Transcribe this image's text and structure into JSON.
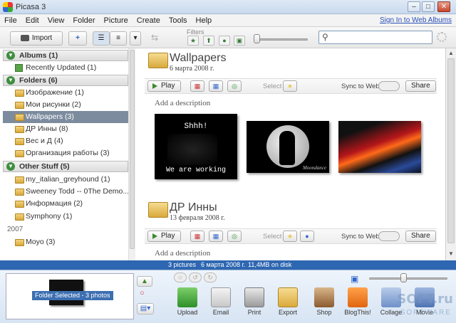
{
  "window": {
    "title": "Picasa 3",
    "minimize": "–",
    "maximize": "□",
    "close": "✕"
  },
  "menu": {
    "items": [
      "File",
      "Edit",
      "View",
      "Folder",
      "Picture",
      "Create",
      "Tools",
      "Help"
    ],
    "signin": "Sign In to Web Albums"
  },
  "toolbar": {
    "import_label": "Import",
    "filters_label": "Filters",
    "search_placeholder": ""
  },
  "sidebar": {
    "sections": [
      {
        "label": "Albums (1)"
      },
      {
        "label": "Folders (6)"
      },
      {
        "label": "Other Stuff (5)"
      }
    ],
    "albums": [
      {
        "label": "Recently Updated (1)"
      }
    ],
    "folders": [
      {
        "label": "Изображение (1)"
      },
      {
        "label": "Мои рисунки (2)"
      },
      {
        "label": "Wallpapers (3)",
        "selected": true
      },
      {
        "label": "ДР Инны (8)"
      },
      {
        "label": "Вес и Д (4)"
      },
      {
        "label": "Организация работы (3)"
      }
    ],
    "other": [
      {
        "label": "my_italian_greyhound (1)"
      },
      {
        "label": "Sweeney Todd -- 0The Demo..."
      },
      {
        "label": "Информация (2)"
      },
      {
        "label": "Symphony (1)"
      }
    ],
    "year": "2007",
    "year_items": [
      {
        "label": "Moyo (3)"
      }
    ]
  },
  "albums_view": [
    {
      "title": "Wallpapers",
      "date": "6 марта 2008 г.",
      "play_label": "Play",
      "select_label": "Select",
      "sync_label": "Sync to Web",
      "share_label": "Share",
      "description_placeholder": "Add a description",
      "thumbs": [
        {
          "line1": "Shhh!",
          "line2": "We are working"
        },
        {
          "caption": "Moondance"
        },
        {
          "caption": ""
        }
      ]
    },
    {
      "title": "ДР Инны",
      "date": "13 февраля 2008 г.",
      "play_label": "Play",
      "select_label": "Select",
      "sync_label": "Sync to Web",
      "share_label": "Share",
      "description_placeholder": "Add a description"
    }
  ],
  "status": {
    "pictures": "3 pictures",
    "date": "6 марта 2008 г.",
    "size": "11,4MB on disk"
  },
  "tray": {
    "selection_label": "Folder Selected - 3 photos",
    "actions": [
      {
        "label": "Upload",
        "icon": "upload-icon",
        "color": "#3fa33f"
      },
      {
        "label": "Email",
        "icon": "email-icon",
        "color": "#d8d8d8"
      },
      {
        "label": "Print",
        "icon": "print-icon",
        "color": "#c9c9c9"
      },
      {
        "label": "Export",
        "icon": "export-icon",
        "color": "#e3b75a"
      },
      {
        "label": "Shop",
        "icon": "shop-icon",
        "color": "#9c6b3e"
      },
      {
        "label": "BlogThis!",
        "icon": "blogger-icon",
        "color": "#f07f1b"
      },
      {
        "label": "Collage",
        "icon": "collage-icon",
        "color": "#8aa9d8"
      },
      {
        "label": "Movie",
        "icon": "movie-icon",
        "color": "#6b8fc8"
      }
    ],
    "watermark": "SOFT.ru",
    "watermark2": "SOFTWARE"
  }
}
